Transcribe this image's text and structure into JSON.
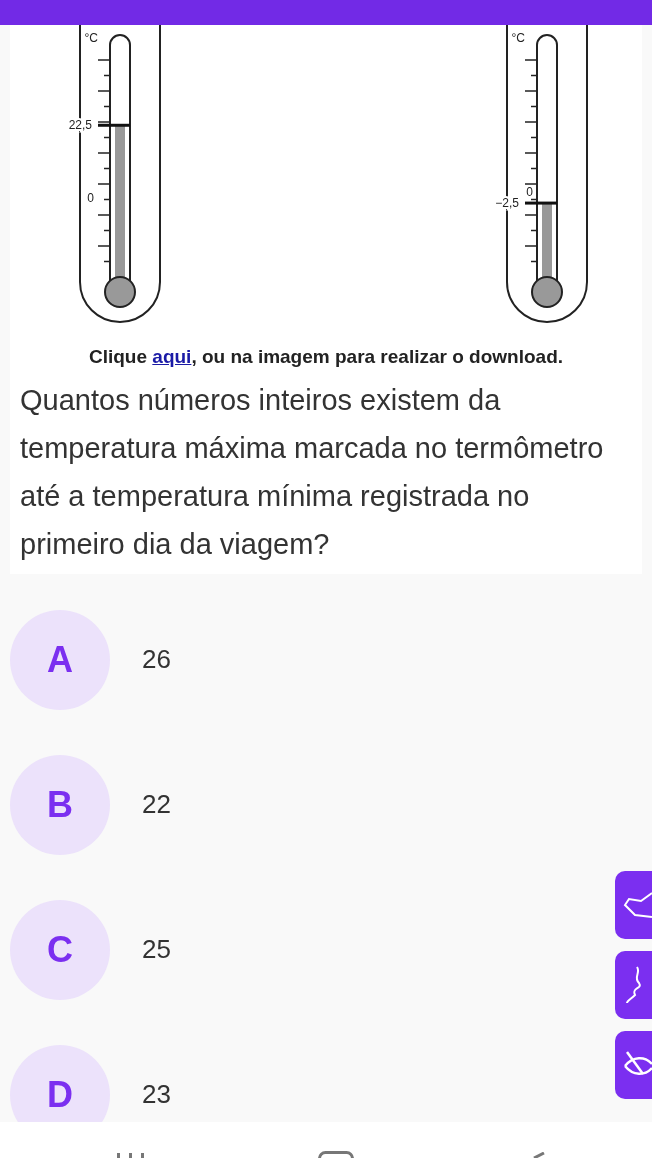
{
  "thermometers": [
    {
      "unit": "°C",
      "reading": "22,5",
      "zero": "0",
      "level": 0.675
    },
    {
      "unit": "°C",
      "reading": "−2,5",
      "zero": "0",
      "level": 0.36
    }
  ],
  "caption": {
    "before": "Clique ",
    "link": "aqui",
    "after": ", ou na imagem para realizar o download."
  },
  "question": "Quantos números inteiros existem da temperatura máxima marcada no termômetro até a temperatura mínima registrada no primeiro dia da viagem?",
  "options": [
    {
      "letter": "A",
      "text": "26"
    },
    {
      "letter": "B",
      "text": "22"
    },
    {
      "letter": "C",
      "text": "25"
    },
    {
      "letter": "D",
      "text": "23"
    }
  ]
}
